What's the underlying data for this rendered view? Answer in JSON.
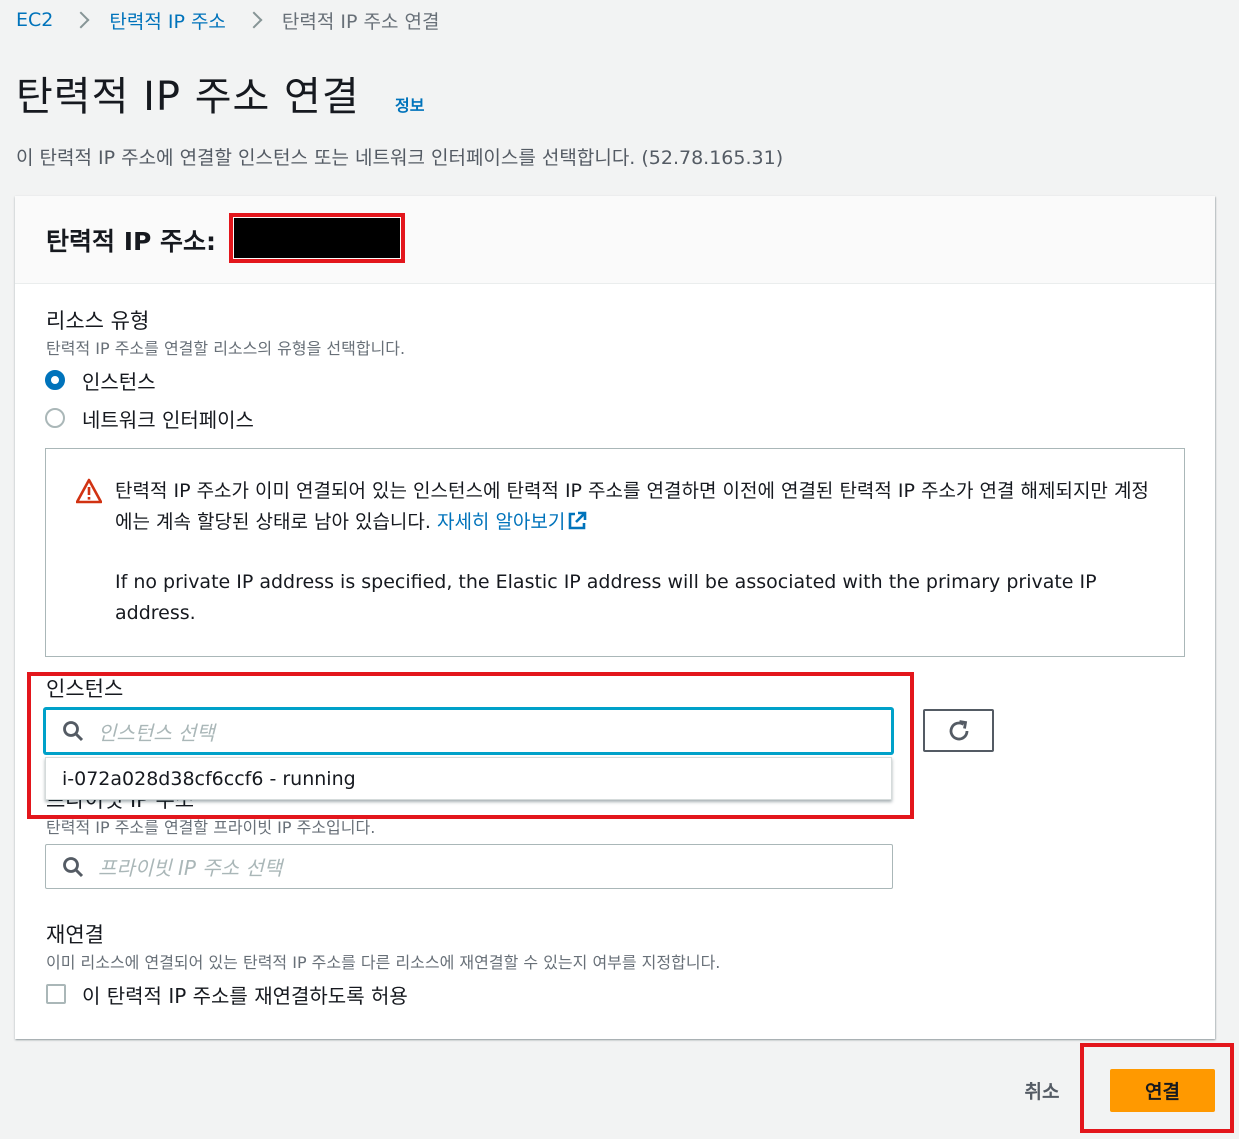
{
  "breadcrumb": {
    "items": [
      "EC2",
      "탄력적 IP 주소",
      "탄력적 IP 주소 연결"
    ]
  },
  "page": {
    "title": "탄력적 IP 주소 연결",
    "info_link": "정보",
    "description": "이 탄력적 IP 주소에 연결할 인스턴스 또는 네트워크 인터페이스를 선택합니다. (52.78.165.31)"
  },
  "panel": {
    "header_label": "탄력적 IP 주소:"
  },
  "resource_type": {
    "label": "리소스 유형",
    "description": "탄력적 IP 주소를 연결할 리소스의 유형을 선택합니다.",
    "options": [
      {
        "label": "인스턴스",
        "selected": true
      },
      {
        "label": "네트워크 인터페이스",
        "selected": false
      }
    ]
  },
  "alert": {
    "text": "탄력적 IP 주소가 이미 연결되어 있는 인스턴스에 탄력적 IP 주소를 연결하면 이전에 연결된 탄력적 IP 주소가 연결 해제되지만 계정에는 계속 할당된 상태로 남아 있습니다.",
    "link": "자세히 알아보기",
    "note": "If no private IP address is specified, the Elastic IP address will be associated with the primary private IP address."
  },
  "instance": {
    "label": "인스턴스",
    "placeholder": "인스턴스 선택",
    "dropdown_option": "i-072a028d38cf6ccf6 - running"
  },
  "private_ip": {
    "label": "프라이빗 IP 주소",
    "description": "탄력적 IP 주소를 연결할 프라이빗 IP 주소입니다.",
    "placeholder": "프라이빗 IP 주소 선택"
  },
  "reassociation": {
    "label": "재연결",
    "description": "이미 리소스에 연결되어 있는 탄력적 IP 주소를 다른 리소스에 재연결할 수 있는지 여부를 지정합니다.",
    "checkbox_label": "이 탄력적 IP 주소를 재연결하도록 허용"
  },
  "actions": {
    "cancel": "취소",
    "associate": "연결"
  },
  "colors": {
    "link": "#0073bb",
    "primary": "#ff9900",
    "highlight": "#e3161c",
    "warning": "#d13212"
  }
}
